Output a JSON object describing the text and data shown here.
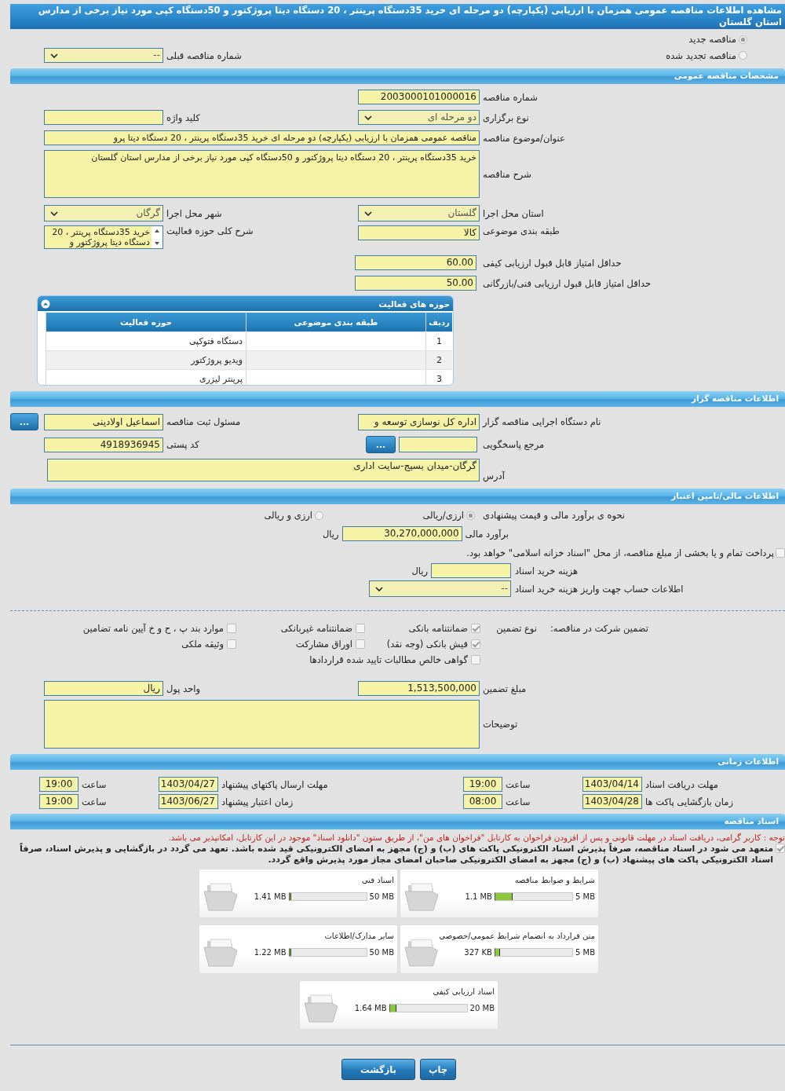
{
  "title": "مشاهده اطلاعات مناقصه عمومی همزمان با ارزیابی (یکپارچه) دو مرحله ای خرید 35دستگاه پرینتر ، 20 دستگاه دیتا پروژکتور و 50دستگاه کپی مورد نیاز برخی از مدارس استان گلستان",
  "tender_options": [
    {
      "label": "مناقصه جدید",
      "selected": true
    },
    {
      "label": "مناقصه تجدید شده",
      "selected": false
    }
  ],
  "previous_tender": {
    "label": "شماره مناقصه قبلی",
    "value": "--"
  },
  "general": {
    "heading": "مشخصات مناقصه عمومی",
    "number": {
      "label": "شماره مناقصه",
      "value": "2003000101000016"
    },
    "holding_type": {
      "label": "نوع برگزاری",
      "value": "دو مرحله ای"
    },
    "keyword": {
      "label": "کلید واژه"
    },
    "subject": {
      "label": "عنوان/موضوع مناقصه",
      "value": "مناقصه عمومی همزمان با ارزیابی (یکپارچه) دو مرحله ای خرید 35دستگاه پرینتر ، 20 دستگاه دیتا پرو"
    },
    "description": {
      "label": "شرح مناقصه",
      "value": "خرید 35دستگاه پرینتر ، 20 دستگاه دیتا پروژکتور و 50دستگاه کپی مورد نیاز برخی از مدارس استان گلستان"
    },
    "province": {
      "label": "استان محل اجرا",
      "value": "گلستان"
    },
    "city": {
      "label": "شهر محل اجرا",
      "value": "گرگان"
    },
    "category": {
      "label": "طبقه بندی موضوعی",
      "value": "کالا"
    },
    "activity_desc": {
      "label": "شرح کلی حوزه فعالیت",
      "value": "خرید 35دستگاه پرینتر ، 20 دستگاه دیتا پروژکتور و"
    },
    "min_quality": {
      "label": "حداقل امتیاز قابل قبول ارزیابی کیفی",
      "value": "60.00"
    },
    "min_technical": {
      "label": "حداقل امتیاز قابل قبول ارزیابی فنی/بازرگانی",
      "value": "50.00"
    },
    "activities": {
      "heading": "حوزه های فعالیت",
      "columns": [
        "ردیف",
        "طبقه بندی موضوعی",
        "حوزه فعالیت"
      ],
      "rows": [
        {
          "index": "1",
          "activity": "دستگاه فتوکپی"
        },
        {
          "index": "2",
          "activity": "ویدیو پروژکتور"
        },
        {
          "index": "3",
          "activity": "پرینتر لیزری"
        }
      ]
    }
  },
  "organizer": {
    "heading": "اطلاعات مناقصه گزار",
    "agency": {
      "label": "نام دستگاه اجرایی مناقصه گزار",
      "value": "اداره کل نوسازی  توسعه و"
    },
    "registrar": {
      "label": "مسئول ثبت مناقصه",
      "value": "اسماعیل اولادینی",
      "button": "..."
    },
    "reference": {
      "label": "مرجع پاسخگویی",
      "button": "..."
    },
    "postal_code": {
      "label": "کد پستی",
      "value": "4918936945"
    },
    "address": {
      "label": "آدرس",
      "value": "گرگان-میدان بسیج-سایت اداری"
    }
  },
  "finance": {
    "heading": "اطلاعات مالی/تامین اعتبار",
    "method_label": "نحوه ی برآورد مالی و قیمت پیشنهادی",
    "methods": [
      {
        "label": "ارزی/ریالی",
        "selected": true
      },
      {
        "label": "ارزی و ریالی",
        "selected": false
      }
    ],
    "estimate": {
      "label": "برآورد مالی",
      "value": "30,270,000,000",
      "unit": "ریال"
    },
    "treasury": {
      "label": "پرداخت تمام و یا بخشی از مبلغ مناقصه، از محل \"اسناد خزانه اسلامی\" خواهد بود.",
      "checked": false
    },
    "doc_fee": {
      "label": "هزینه خرید اسناد",
      "unit": "ریال"
    },
    "account": {
      "label": "اطلاعات حساب جهت واریز هزینه خرید اسناد",
      "value": "--"
    }
  },
  "guarantee": {
    "label": "تضمین شرکت در مناقصه:",
    "type_label": "نوع تضمین",
    "options": [
      {
        "label": "ضمانتنامه بانکی",
        "checked": true
      },
      {
        "label": "ضمانتنامه غیربانکی",
        "checked": false
      },
      {
        "label": "موارد بند پ ، ح و خ آیین نامه تضامین",
        "checked": false
      },
      {
        "label": "فیش بانکی (وجه نقد)",
        "checked": true
      },
      {
        "label": "اوراق مشارکت",
        "checked": false
      },
      {
        "label": "وثیقه ملکی",
        "checked": false
      },
      {
        "label": "گواهی خالص مطالبات تایید شده قراردادها",
        "checked": false
      }
    ],
    "amount": {
      "label": "مبلغ تضمین",
      "value": "1,513,500,000"
    },
    "currency": {
      "label": "واحد پول",
      "value": "ریال"
    },
    "notes": {
      "label": "توضیحات"
    }
  },
  "schedule": {
    "heading": "اطلاعات زمانی",
    "items": [
      {
        "label": "مهلت دریافت اسناد",
        "date": "1403/04/14",
        "time_label": "ساعت",
        "time": "19:00"
      },
      {
        "label": "مهلت ارسال پاکتهای پیشنهاد",
        "date": "1403/04/27",
        "time_label": "ساعت",
        "time": "19:00"
      },
      {
        "label": "زمان بازگشایی پاکت ها",
        "date": "1403/04/28",
        "time_label": "ساعت",
        "time": "08:00"
      },
      {
        "label": "زمان اعتبار پیشنهاد",
        "date": "1403/06/27",
        "time_label": "ساعت",
        "time": "19:00"
      }
    ]
  },
  "documents": {
    "heading": "اسناد مناقصه",
    "notice": "توجه : کاربر گرامی، دریافت اسناد در مهلت قانونی و پس از افزودن فراخوان به کارتابل \"فراخوان های من\"، از طریق ستون \"دانلود اسناد\" موجود در این کارتابل، امکانپذیر می باشد.",
    "commitment": {
      "text": "متعهد می شود در اسناد مناقصه، صرفاً پذیرش اسناد الکترونیکی پاکت های (ب) و (ج) مجهز به امضای الکترونیکی قید شده باشد. تعهد می گردد در بازگشایی و پذیرش اسناد، صرفاً اسناد الکترونیکی پاکت های پیشنهاد (ب) و (ج) مجهز به امضای الکترونیکی صاحبان امضای مجاز مورد پذیرش واقع گردد.",
      "checked": true
    },
    "files": [
      {
        "name": "شرایط و ضوابط مناقصه",
        "size": "1.1 MB",
        "limit": "5 MB",
        "level": 0.22
      },
      {
        "name": "اسناد فنی",
        "size": "1.41 MB",
        "limit": "50 MB",
        "level": 0.028
      },
      {
        "name": "متن قرارداد به انضمام شرایط عمومی/خصوصی",
        "size": "327 KB",
        "limit": "5 MB",
        "level": 0.065
      },
      {
        "name": "سایر مدارک/اطلاعات",
        "size": "1.22 MB",
        "limit": "50 MB",
        "level": 0.024
      },
      {
        "name": "اسناد ارزیابی کیفی",
        "size": "1.64 MB",
        "limit": "20 MB",
        "level": 0.082
      }
    ]
  },
  "buttons": [
    "چاپ",
    "بازگشت"
  ]
}
